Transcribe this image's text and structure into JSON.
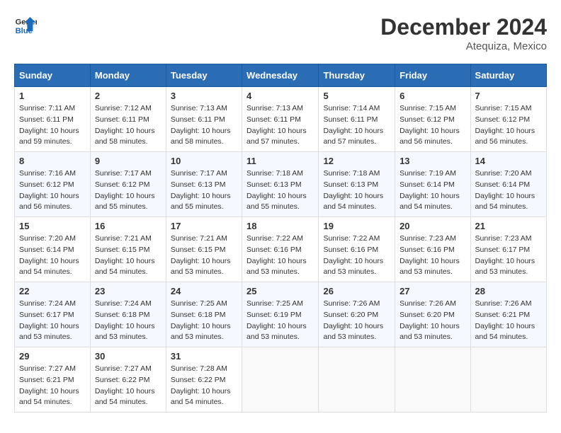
{
  "header": {
    "logo_line1": "General",
    "logo_line2": "Blue",
    "month": "December 2024",
    "location": "Atequiza, Mexico"
  },
  "weekdays": [
    "Sunday",
    "Monday",
    "Tuesday",
    "Wednesday",
    "Thursday",
    "Friday",
    "Saturday"
  ],
  "weeks": [
    [
      {
        "day": "1",
        "sunrise": "7:11 AM",
        "sunset": "6:11 PM",
        "daylight": "10 hours and 59 minutes."
      },
      {
        "day": "2",
        "sunrise": "7:12 AM",
        "sunset": "6:11 PM",
        "daylight": "10 hours and 58 minutes."
      },
      {
        "day": "3",
        "sunrise": "7:13 AM",
        "sunset": "6:11 PM",
        "daylight": "10 hours and 58 minutes."
      },
      {
        "day": "4",
        "sunrise": "7:13 AM",
        "sunset": "6:11 PM",
        "daylight": "10 hours and 57 minutes."
      },
      {
        "day": "5",
        "sunrise": "7:14 AM",
        "sunset": "6:11 PM",
        "daylight": "10 hours and 57 minutes."
      },
      {
        "day": "6",
        "sunrise": "7:15 AM",
        "sunset": "6:12 PM",
        "daylight": "10 hours and 56 minutes."
      },
      {
        "day": "7",
        "sunrise": "7:15 AM",
        "sunset": "6:12 PM",
        "daylight": "10 hours and 56 minutes."
      }
    ],
    [
      {
        "day": "8",
        "sunrise": "7:16 AM",
        "sunset": "6:12 PM",
        "daylight": "10 hours and 56 minutes."
      },
      {
        "day": "9",
        "sunrise": "7:17 AM",
        "sunset": "6:12 PM",
        "daylight": "10 hours and 55 minutes."
      },
      {
        "day": "10",
        "sunrise": "7:17 AM",
        "sunset": "6:13 PM",
        "daylight": "10 hours and 55 minutes."
      },
      {
        "day": "11",
        "sunrise": "7:18 AM",
        "sunset": "6:13 PM",
        "daylight": "10 hours and 55 minutes."
      },
      {
        "day": "12",
        "sunrise": "7:18 AM",
        "sunset": "6:13 PM",
        "daylight": "10 hours and 54 minutes."
      },
      {
        "day": "13",
        "sunrise": "7:19 AM",
        "sunset": "6:14 PM",
        "daylight": "10 hours and 54 minutes."
      },
      {
        "day": "14",
        "sunrise": "7:20 AM",
        "sunset": "6:14 PM",
        "daylight": "10 hours and 54 minutes."
      }
    ],
    [
      {
        "day": "15",
        "sunrise": "7:20 AM",
        "sunset": "6:14 PM",
        "daylight": "10 hours and 54 minutes."
      },
      {
        "day": "16",
        "sunrise": "7:21 AM",
        "sunset": "6:15 PM",
        "daylight": "10 hours and 54 minutes."
      },
      {
        "day": "17",
        "sunrise": "7:21 AM",
        "sunset": "6:15 PM",
        "daylight": "10 hours and 53 minutes."
      },
      {
        "day": "18",
        "sunrise": "7:22 AM",
        "sunset": "6:16 PM",
        "daylight": "10 hours and 53 minutes."
      },
      {
        "day": "19",
        "sunrise": "7:22 AM",
        "sunset": "6:16 PM",
        "daylight": "10 hours and 53 minutes."
      },
      {
        "day": "20",
        "sunrise": "7:23 AM",
        "sunset": "6:16 PM",
        "daylight": "10 hours and 53 minutes."
      },
      {
        "day": "21",
        "sunrise": "7:23 AM",
        "sunset": "6:17 PM",
        "daylight": "10 hours and 53 minutes."
      }
    ],
    [
      {
        "day": "22",
        "sunrise": "7:24 AM",
        "sunset": "6:17 PM",
        "daylight": "10 hours and 53 minutes."
      },
      {
        "day": "23",
        "sunrise": "7:24 AM",
        "sunset": "6:18 PM",
        "daylight": "10 hours and 53 minutes."
      },
      {
        "day": "24",
        "sunrise": "7:25 AM",
        "sunset": "6:18 PM",
        "daylight": "10 hours and 53 minutes."
      },
      {
        "day": "25",
        "sunrise": "7:25 AM",
        "sunset": "6:19 PM",
        "daylight": "10 hours and 53 minutes."
      },
      {
        "day": "26",
        "sunrise": "7:26 AM",
        "sunset": "6:20 PM",
        "daylight": "10 hours and 53 minutes."
      },
      {
        "day": "27",
        "sunrise": "7:26 AM",
        "sunset": "6:20 PM",
        "daylight": "10 hours and 53 minutes."
      },
      {
        "day": "28",
        "sunrise": "7:26 AM",
        "sunset": "6:21 PM",
        "daylight": "10 hours and 54 minutes."
      }
    ],
    [
      {
        "day": "29",
        "sunrise": "7:27 AM",
        "sunset": "6:21 PM",
        "daylight": "10 hours and 54 minutes."
      },
      {
        "day": "30",
        "sunrise": "7:27 AM",
        "sunset": "6:22 PM",
        "daylight": "10 hours and 54 minutes."
      },
      {
        "day": "31",
        "sunrise": "7:28 AM",
        "sunset": "6:22 PM",
        "daylight": "10 hours and 54 minutes."
      },
      null,
      null,
      null,
      null
    ]
  ]
}
